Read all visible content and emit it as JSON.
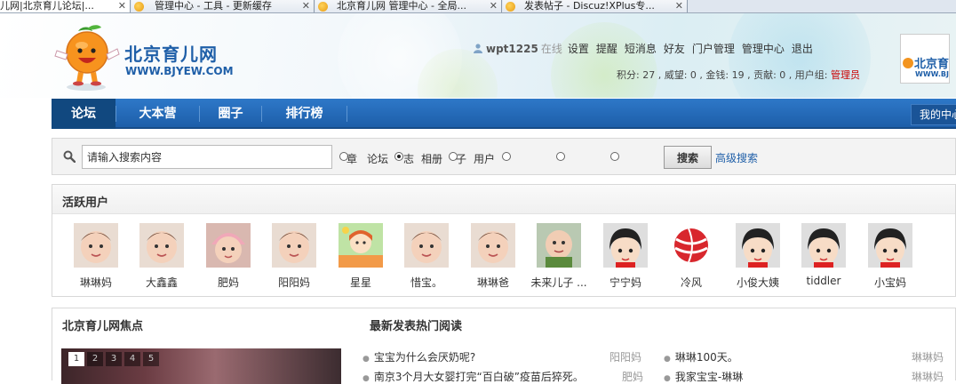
{
  "browser": {
    "tabs": [
      {
        "title": "儿网|北京育儿论坛|..."
      },
      {
        "title": "管理中心 - 工具 - 更新缓存"
      },
      {
        "title": "北京育儿网 管理中心 - 全局..."
      },
      {
        "title": "发表帖子 - Discuz!XPlus专..."
      }
    ],
    "close_glyph": "✕"
  },
  "header": {
    "logo_cn": "北京育儿网",
    "logo_en": "WWW.BJYEW.COM",
    "username": "wpt1225",
    "online": "在线",
    "links": [
      "设置",
      "提醒",
      "短消息",
      "好友",
      "门户管理",
      "管理中心",
      "退出"
    ],
    "stats_prefix": "积分: 27 , 威望: 0 , 金钱: 19 , 贡献: 0 , 用户组: ",
    "role": "管理员",
    "ad_cn": "北京育",
    "ad_en": "WWW.BJY"
  },
  "nav": {
    "items": [
      "论坛",
      "大本营",
      "圈子",
      "排行榜"
    ],
    "my_center": "我的中心",
    "caret": "▼"
  },
  "search": {
    "value": "请输入搜索内容",
    "options": [
      "章",
      "论坛",
      "志",
      "相册",
      "子",
      "用户"
    ],
    "button": "搜索",
    "advanced": "高级搜索"
  },
  "active_users": {
    "title": "活跃用户",
    "users": [
      {
        "name": "琳琳妈",
        "avatar": "baby"
      },
      {
        "name": "大鑫鑫",
        "avatar": "baby"
      },
      {
        "name": "肥妈",
        "avatar": "baby-hat"
      },
      {
        "name": "阳阳妈",
        "avatar": "baby"
      },
      {
        "name": "星星",
        "avatar": "cartoon-girl"
      },
      {
        "name": "惜宝。",
        "avatar": "baby"
      },
      {
        "name": "琳琳爸",
        "avatar": "baby"
      },
      {
        "name": "未来儿子 ...",
        "avatar": "baby-green"
      },
      {
        "name": "宁宁妈",
        "avatar": "default-cartoon"
      },
      {
        "name": "冷风",
        "avatar": "red-ball"
      },
      {
        "name": "小俊大姨",
        "avatar": "default-cartoon"
      },
      {
        "name": "tiddler",
        "avatar": "default-cartoon"
      },
      {
        "name": "小宝妈",
        "avatar": "default-cartoon"
      }
    ]
  },
  "bottom": {
    "focus_title": "北京育儿网焦点",
    "hot_title": "最新发表热门阅读",
    "pager": [
      "1",
      "2",
      "3",
      "4",
      "5"
    ],
    "hot_left": [
      {
        "title": "宝宝为什么会厌奶呢?",
        "author": "阳阳妈"
      },
      {
        "title": "南京3个月大女婴打完“百白破”疫苗后猝死。",
        "author": "肥妈"
      }
    ],
    "hot_right": [
      {
        "title": "琳琳100天。",
        "author": "琳琳妈"
      },
      {
        "title": "我家宝宝-琳琳",
        "author": "琳琳妈"
      }
    ],
    "bullet": "●"
  }
}
